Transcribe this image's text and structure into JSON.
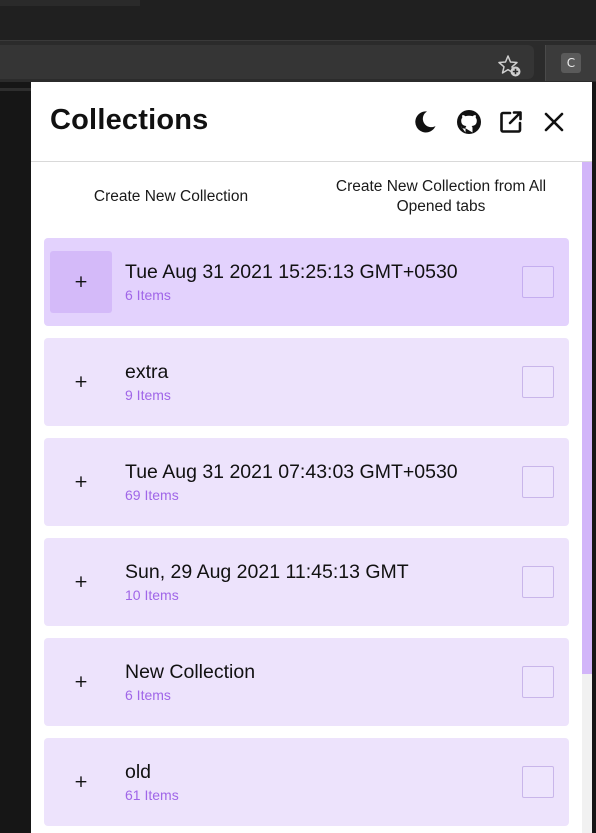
{
  "browser": {
    "extension_button_label": "C",
    "bookmark_icon": "star-add-icon"
  },
  "popup": {
    "title": "Collections",
    "header_icons": [
      "moon-icon",
      "github-icon",
      "open-external-icon",
      "close-icon"
    ],
    "actions": {
      "create_new": "Create New Collection",
      "create_from_tabs": "Create New Collection from All Opened tabs"
    },
    "collections": [
      {
        "name": "Tue Aug 31 2021 15:25:13 GMT+0530",
        "count": "6 Items",
        "expand": "+"
      },
      {
        "name": "extra",
        "count": "9 Items",
        "expand": "+"
      },
      {
        "name": "Tue Aug 31 2021 07:43:03 GMT+0530",
        "count": "69 Items",
        "expand": "+"
      },
      {
        "name": "Sun, 29 Aug 2021 11:45:13 GMT",
        "count": "10 Items",
        "expand": "+"
      },
      {
        "name": "New Collection",
        "count": "6 Items",
        "expand": "+"
      },
      {
        "name": "old",
        "count": "61 Items",
        "expand": "+"
      }
    ]
  },
  "colors": {
    "card_bg": "#ede3fc",
    "card_active_bg": "#e3d2fd",
    "count_text": "#a066e8",
    "scrollbar_thumb": "#d2b5f9"
  }
}
